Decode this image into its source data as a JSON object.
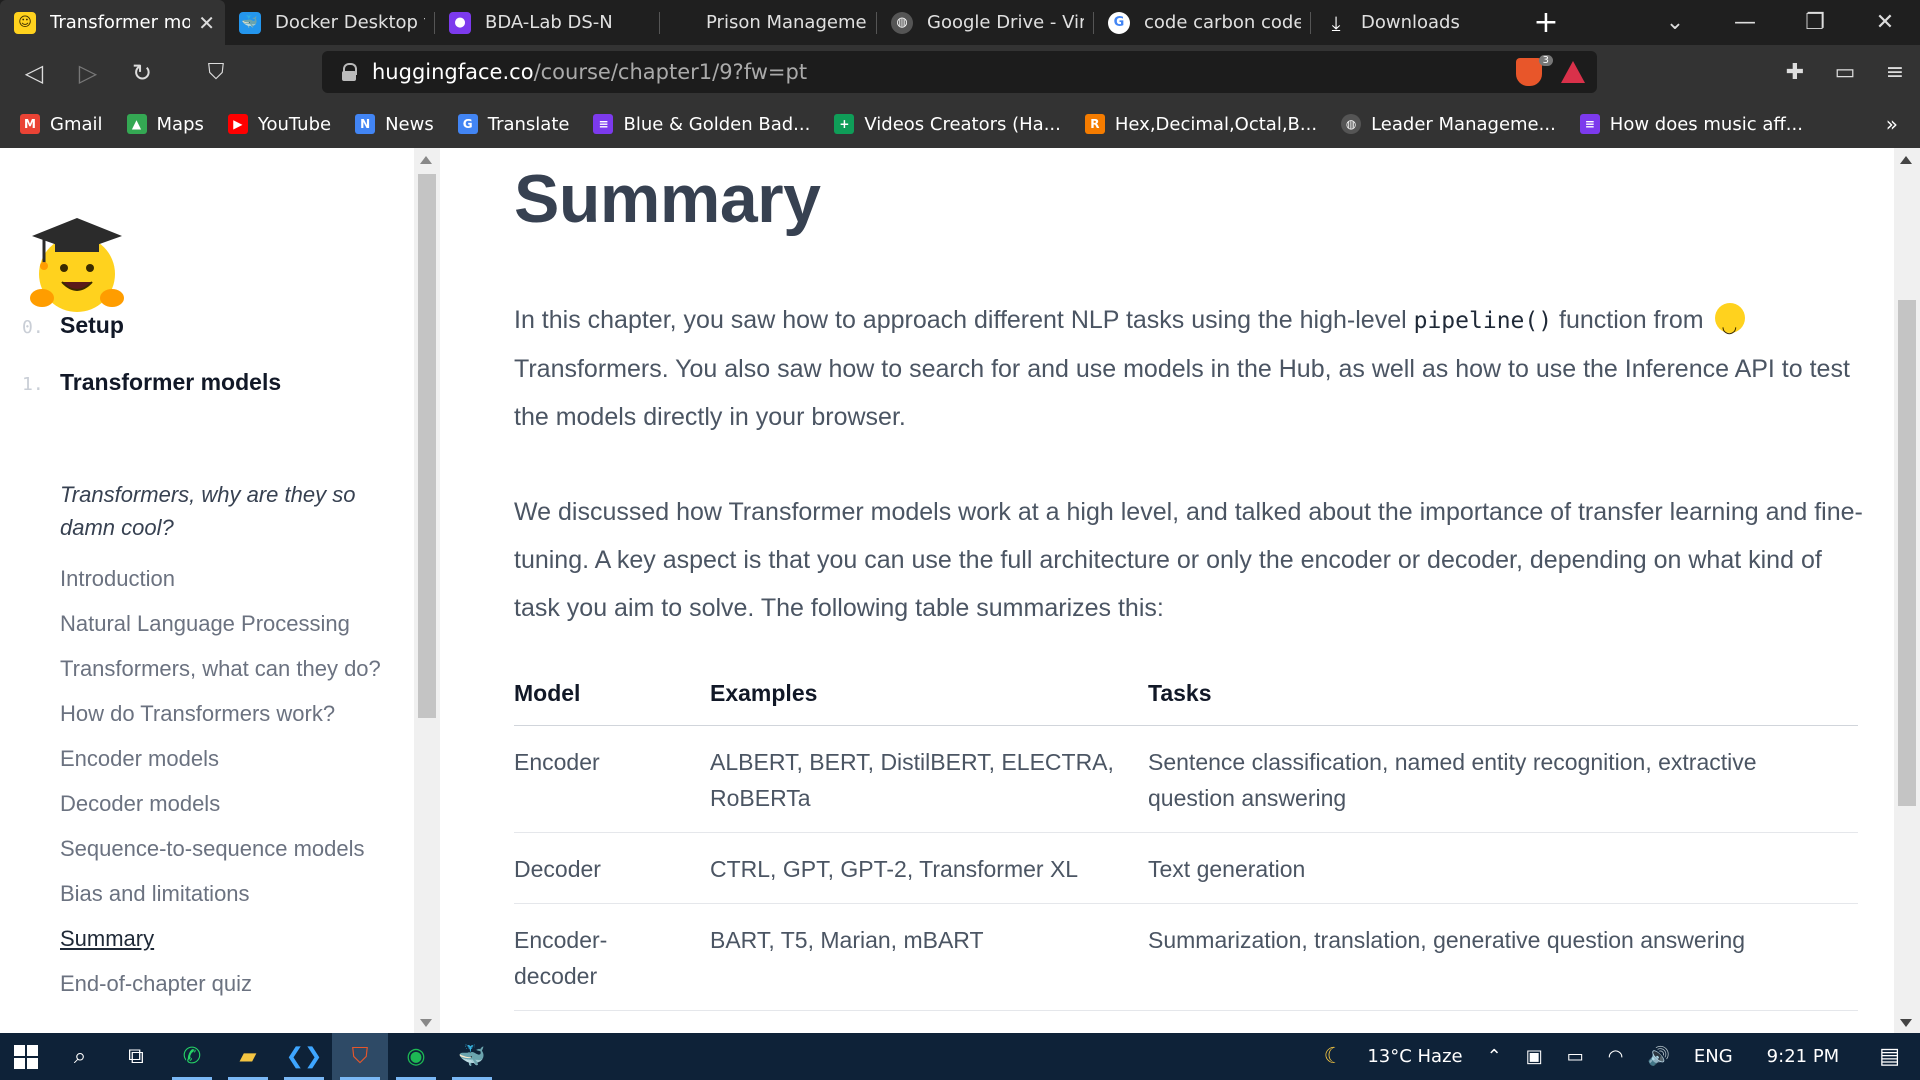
{
  "browser": {
    "tabs": [
      {
        "title": "Transformer models",
        "icon": "hugging-face-icon",
        "color": "#ffd21e",
        "active": true
      },
      {
        "title": "Docker Desktop for",
        "icon": "docker-icon",
        "color": "#2496ed"
      },
      {
        "title": "BDA-Lab DS-N",
        "icon": "classroom-icon",
        "color": "#7c3aed"
      },
      {
        "title": "Prison Management",
        "icon": "blank-icon",
        "color": "#1f1f1f"
      },
      {
        "title": "Google Drive - Virus",
        "icon": "globe-icon",
        "color": "#555"
      },
      {
        "title": "code carbon code p",
        "icon": "google-icon",
        "color": "#ffffff"
      },
      {
        "title": "Downloads",
        "icon": "download-icon",
        "color": "#1f1f1f"
      }
    ],
    "new_tab_symbol": "+",
    "window_controls": {
      "minimize": "—",
      "maximize": "❐",
      "close": "✕"
    },
    "url": {
      "host": "huggingface.co",
      "path": "/course/chapter1/9?fw=pt"
    },
    "brave_shield_count": "3",
    "bookmarks": [
      {
        "label": "Gmail",
        "icon": "gmail-icon",
        "color": "#ea4335",
        "glyph": "M"
      },
      {
        "label": "Maps",
        "icon": "maps-icon",
        "color": "#34a853",
        "glyph": "▲"
      },
      {
        "label": "YouTube",
        "icon": "youtube-icon",
        "color": "#ff0000",
        "glyph": "▶"
      },
      {
        "label": "News",
        "icon": "news-icon",
        "color": "#4285f4",
        "glyph": "N"
      },
      {
        "label": "Translate",
        "icon": "translate-icon",
        "color": "#4285f4",
        "glyph": "G"
      },
      {
        "label": "Blue & Golden Bad...",
        "icon": "forms-icon",
        "color": "#7c3aed",
        "glyph": "≡"
      },
      {
        "label": "Videos Creators (Ha...",
        "icon": "sheets-icon",
        "color": "#0f9d58",
        "glyph": "+"
      },
      {
        "label": "Hex,Decimal,Octal,B...",
        "icon": "r-icon",
        "color": "#f57c00",
        "glyph": "R"
      },
      {
        "label": "Leader Manageme...",
        "icon": "globe-icon",
        "color": "#555555",
        "glyph": "◍"
      },
      {
        "label": "How does music aff...",
        "icon": "forms-icon",
        "color": "#7c3aed",
        "glyph": "≡"
      }
    ],
    "bookmarks_more": "»"
  },
  "sidebar": {
    "chapters": [
      {
        "num": "0.",
        "title": "Setup"
      },
      {
        "num": "1.",
        "title": "Transformer models"
      }
    ],
    "items": [
      {
        "label": "Transformers, why are they so damn cool?"
      },
      {
        "label": "Introduction"
      },
      {
        "label": "Natural Language Processing"
      },
      {
        "label": "Transformers, what can they do?"
      },
      {
        "label": "How do Transformers work?"
      },
      {
        "label": "Encoder models"
      },
      {
        "label": "Decoder models"
      },
      {
        "label": "Sequence-to-sequence models"
      },
      {
        "label": "Bias and limitations"
      },
      {
        "label": "Summary"
      },
      {
        "label": "End-of-chapter quiz"
      }
    ]
  },
  "main": {
    "title": "Summary",
    "para1": {
      "before": "In this chapter, you saw how to approach different NLP tasks using the high-level ",
      "code": "pipeline()",
      "middle": " function from ",
      "after": " Transformers. You also saw how to search for and use models in the Hub, as well as how to use the Inference API to test the models directly in your browser."
    },
    "para2": "We discussed how Transformer models work at a high level, and talked about the importance of transfer learning and fine-tuning. A key aspect is that you can use the full architecture or only the encoder or decoder, depending on what kind of task you aim to solve. The following table summarizes this:",
    "table": {
      "headers": [
        "Model",
        "Examples",
        "Tasks"
      ],
      "rows": [
        [
          "Encoder",
          "ALBERT, BERT, DistilBERT, ELECTRA, RoBERTa",
          "Sentence classification, named entity recognition, extractive question answering"
        ],
        [
          "Decoder",
          "CTRL, GPT, GPT-2, Transformer XL",
          "Text generation"
        ],
        [
          "Encoder-decoder",
          "BART, T5, Marian, mBART",
          "Summarization, translation, generative question answering"
        ]
      ]
    }
  },
  "taskbar": {
    "weather": "13°C  Haze",
    "language": "ENG",
    "time": "9:21 PM"
  }
}
